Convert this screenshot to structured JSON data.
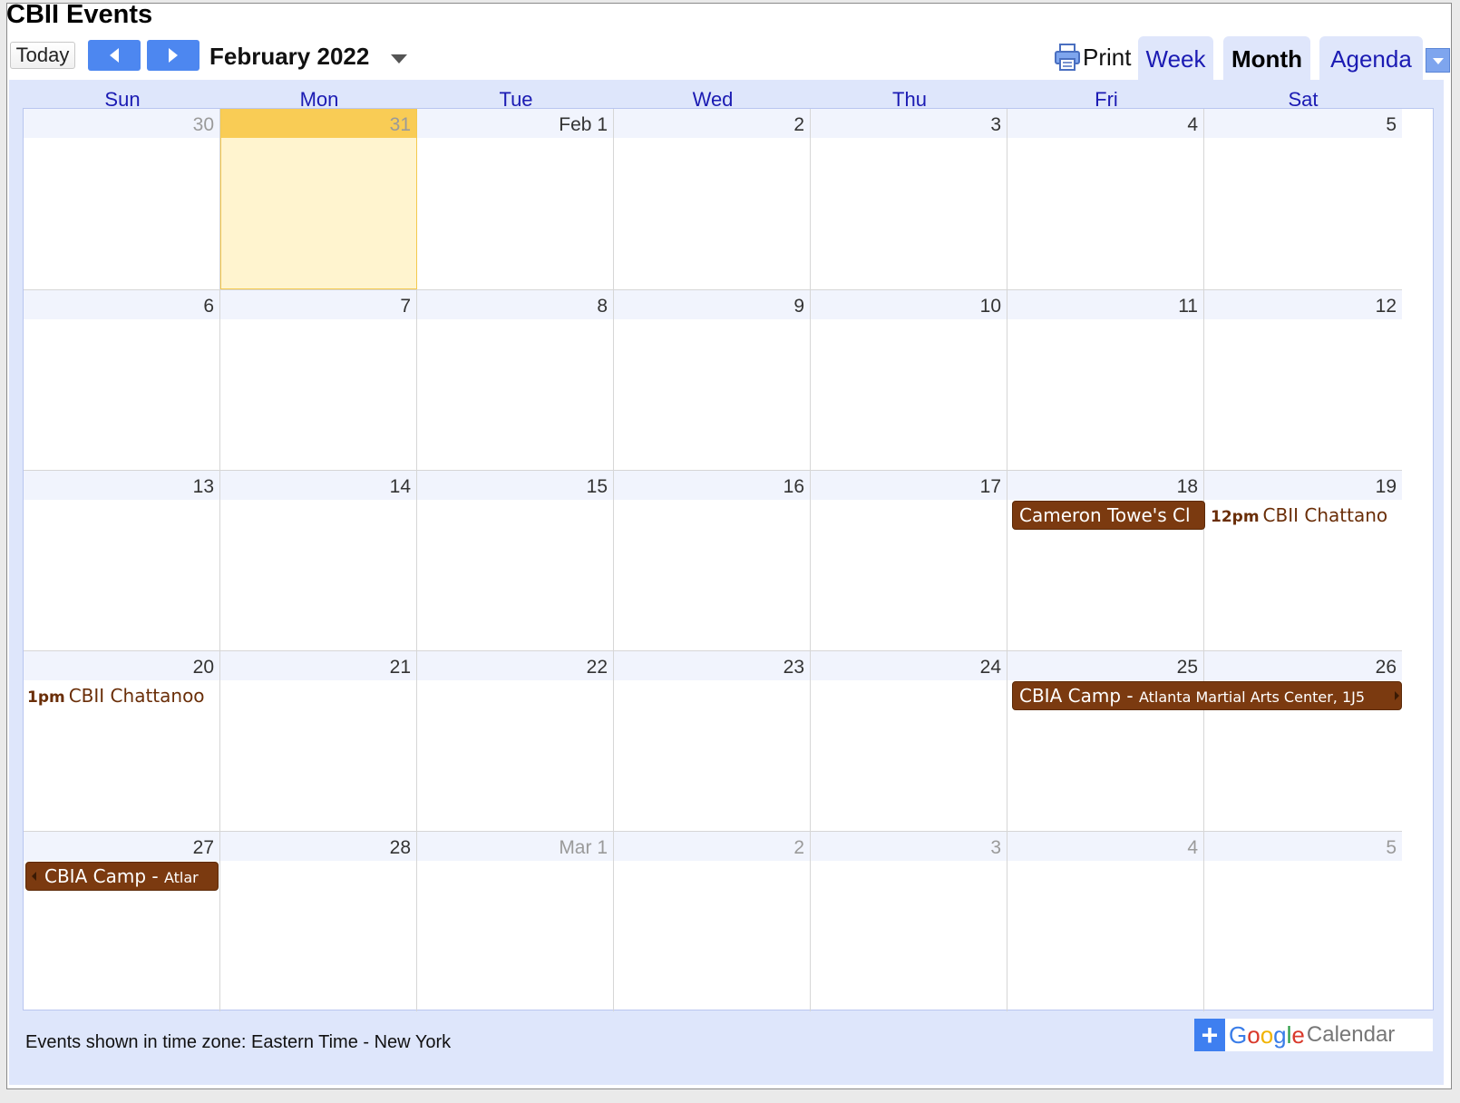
{
  "title": "CBII Events",
  "toolbar": {
    "today_label": "Today",
    "date_label": "February 2022",
    "print_label": "Print",
    "tabs": [
      {
        "label": "Week"
      },
      {
        "label": "Month"
      },
      {
        "label": "Agenda"
      }
    ]
  },
  "days_of_week": [
    "Sun",
    "Mon",
    "Tue",
    "Wed",
    "Thu",
    "Fri",
    "Sat"
  ],
  "weeks": [
    [
      "30",
      "31",
      "Feb 1",
      "2",
      "3",
      "4",
      "5"
    ],
    [
      "6",
      "7",
      "8",
      "9",
      "10",
      "11",
      "12"
    ],
    [
      "13",
      "14",
      "15",
      "16",
      "17",
      "18",
      "19"
    ],
    [
      "20",
      "21",
      "22",
      "23",
      "24",
      "25",
      "26"
    ],
    [
      "27",
      "28",
      "Mar 1",
      "2",
      "3",
      "4",
      "5"
    ]
  ],
  "events": {
    "cameron": {
      "title": "Cameron Towe's Cl"
    },
    "cbii_sat": {
      "time": "12pm",
      "title": "CBII Chattano"
    },
    "cbii_sun": {
      "time": "1pm",
      "title": "CBII Chattanoo"
    },
    "cbia_camp": {
      "title": "CBIA Camp",
      "sep": " - ",
      "location": "Atlanta Martial Arts Center, 1J5"
    },
    "cbia_camp_cont": {
      "title": "CBIA Camp",
      "sep": " - ",
      "location": "Atlar"
    }
  },
  "footer": {
    "timezone": "Events shown in time zone: Eastern Time - New York",
    "gcal_plus": "+",
    "gcal_google": [
      "G",
      "o",
      "o",
      "g",
      "l",
      "e"
    ],
    "gcal_calendar": "Calendar"
  },
  "colors": {
    "event": "#7b3a10",
    "today": "#fff4cf",
    "accent": "#4d87f0"
  }
}
